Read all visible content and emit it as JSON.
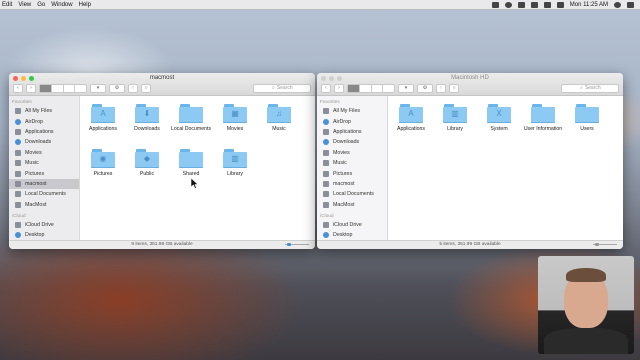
{
  "menubar": {
    "items": [
      "Edit",
      "View",
      "Go",
      "Window",
      "Help"
    ],
    "clock": "Mon 11:25 AM"
  },
  "windows": [
    {
      "title": "macmost",
      "search_placeholder": "Search",
      "sidebar": {
        "sections": [
          {
            "heading": "Favorites",
            "items": [
              "All My Files",
              "AirDrop",
              "Applications",
              "Downloads",
              "Movies",
              "Music",
              "Pictures",
              "macmost",
              "Local Documents",
              "MacMost"
            ]
          },
          {
            "heading": "iCloud",
            "items": [
              "iCloud Drive",
              "Desktop"
            ]
          }
        ],
        "selected": "macmost"
      },
      "folders": [
        "Applications",
        "Downloads",
        "Local Documents",
        "Movies",
        "Music",
        "Pictures",
        "Public",
        "Shared",
        "Library"
      ],
      "status": "9 items, 351.98 GB available"
    },
    {
      "title": "Macintosh HD",
      "search_placeholder": "Search",
      "sidebar": {
        "sections": [
          {
            "heading": "Favorites",
            "items": [
              "All My Files",
              "AirDrop",
              "Applications",
              "Downloads",
              "Movies",
              "Music",
              "Pictures",
              "macmost",
              "Local Documents",
              "MacMost"
            ]
          },
          {
            "heading": "iCloud",
            "items": [
              "iCloud Drive",
              "Desktop"
            ]
          }
        ],
        "selected": ""
      },
      "folders": [
        "Applications",
        "Library",
        "System",
        "User Information",
        "Users"
      ],
      "status": "5 items, 351.99 GB available"
    }
  ],
  "icons": {
    "Applications": "A",
    "Downloads": "⬇",
    "Local Documents": "",
    "Movies": "▦",
    "Music": "♫",
    "Pictures": "◉",
    "Public": "◆",
    "Shared": "",
    "Library": "▥",
    "System": "X",
    "User Information": "",
    "Users": ""
  },
  "colors": {
    "accent": "#4a90d9",
    "folder": "#8ccaf3"
  }
}
